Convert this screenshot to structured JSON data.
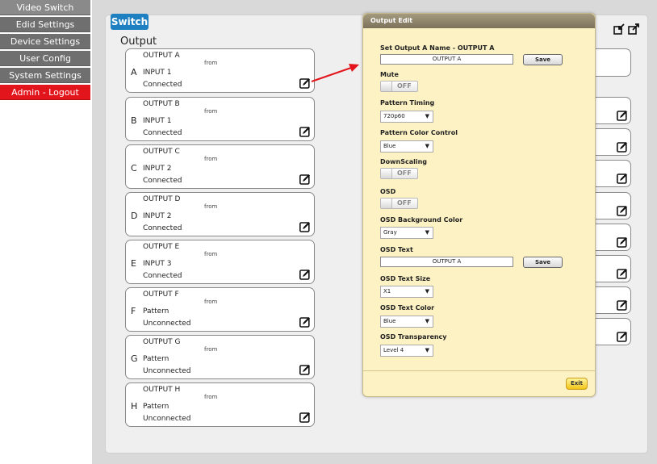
{
  "sidebar": {
    "items": [
      {
        "label": "Video Switch"
      },
      {
        "label": "Edid Settings"
      },
      {
        "label": "Device Settings"
      },
      {
        "label": "User Config"
      },
      {
        "label": "System Settings"
      },
      {
        "label": "Admin - Logout"
      }
    ]
  },
  "main": {
    "tab_label": "Switch",
    "section_title": "Output",
    "from_label": "from",
    "outputs": [
      {
        "letter": "A",
        "name": "OUTPUT A",
        "source": "INPUT 1",
        "status": "Connected"
      },
      {
        "letter": "B",
        "name": "OUTPUT B",
        "source": "INPUT 1",
        "status": "Connected"
      },
      {
        "letter": "C",
        "name": "OUTPUT C",
        "source": "INPUT 2",
        "status": "Connected"
      },
      {
        "letter": "D",
        "name": "OUTPUT D",
        "source": "INPUT 2",
        "status": "Connected"
      },
      {
        "letter": "E",
        "name": "OUTPUT E",
        "source": "INPUT 3",
        "status": "Connected"
      },
      {
        "letter": "F",
        "name": "OUTPUT F",
        "source": "Pattern",
        "status": "Unconnected"
      },
      {
        "letter": "G",
        "name": "OUTPUT G",
        "source": "Pattern",
        "status": "Unconnected"
      },
      {
        "letter": "H",
        "name": "OUTPUT H",
        "source": "Pattern",
        "status": "Unconnected"
      }
    ]
  },
  "dialog": {
    "title": "Output Edit",
    "set_name_label": "Set Output A Name - OUTPUT A",
    "name_value": "OUTPUT A",
    "save_label": "Save",
    "mute_label": "Mute",
    "mute_state": "OFF",
    "pattern_timing_label": "Pattern Timing",
    "pattern_timing_value": "720p60",
    "pattern_color_label": "Pattern Color Control",
    "pattern_color_value": "Blue",
    "downscaling_label": "DownScaling",
    "downscaling_state": "OFF",
    "osd_label": "OSD",
    "osd_state": "OFF",
    "osd_bg_color_label": "OSD Background Color",
    "osd_bg_color_value": "Gray",
    "osd_text_label": "OSD Text",
    "osd_text_value": "OUTPUT A",
    "osd_save_label": "Save",
    "osd_text_size_label": "OSD Text Size",
    "osd_text_size_value": "X1",
    "osd_text_color_label": "OSD Text Color",
    "osd_text_color_value": "Blue",
    "osd_transparency_label": "OSD Transparency",
    "osd_transparency_value": "Level 4",
    "exit_label": "Exit"
  },
  "colors": {
    "accent": "#1e7fc1",
    "logout": "#e3151c",
    "dialog_bg": "#fdf2c4",
    "arrow": "#e3151c"
  }
}
